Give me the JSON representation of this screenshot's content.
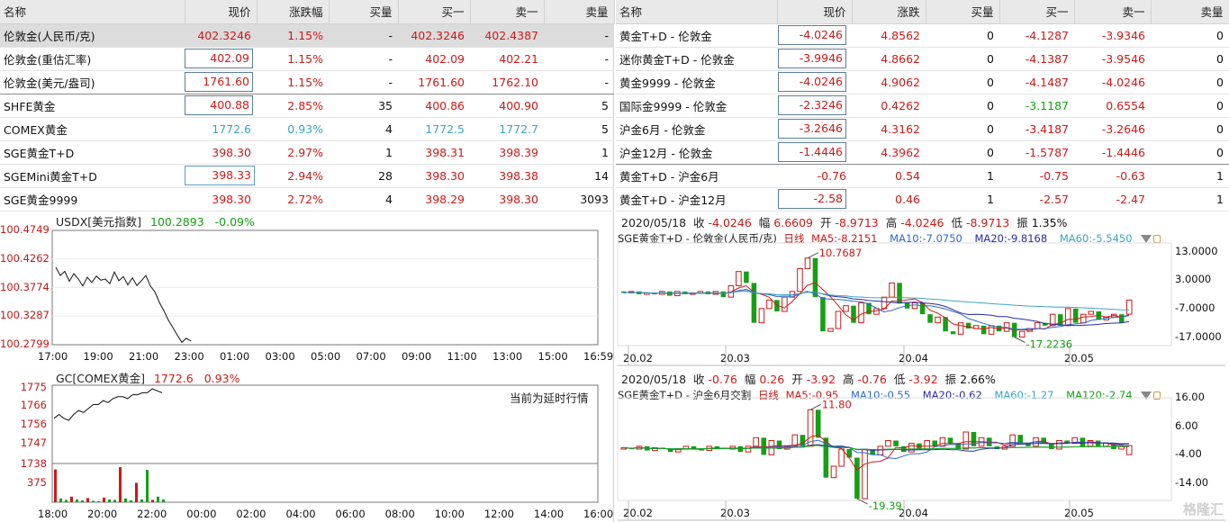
{
  "left_table": {
    "headers": [
      "名称",
      "现价",
      "涨跌幅",
      "买量",
      "买一",
      "卖一",
      "卖量"
    ],
    "rows": [
      {
        "name": "伦敦金(人民币/克)",
        "price": "402.3246",
        "chg": "1.15%",
        "bvol": "-",
        "bid": "402.3246",
        "ask": "402.4387",
        "avol": "-"
      },
      {
        "name": "伦敦金(重估汇率)",
        "price": "402.09",
        "chg": "1.15%",
        "bvol": "-",
        "bid": "402.09",
        "ask": "402.21",
        "avol": "-"
      },
      {
        "name": "伦敦金(美元/盎司)",
        "price": "1761.60",
        "chg": "1.15%",
        "bvol": "-",
        "bid": "1761.60",
        "ask": "1762.10",
        "avol": "-"
      },
      {
        "name": "SHFE黄金",
        "price": "400.88",
        "chg": "2.85%",
        "bvol": "35",
        "bid": "400.86",
        "ask": "400.90",
        "avol": "5"
      },
      {
        "name": "COMEX黄金",
        "price": "1772.6",
        "chg": "0.93%",
        "bvol": "4",
        "bid": "1772.5",
        "ask": "1772.7",
        "avol": "5"
      },
      {
        "name": "SGE黄金T+D",
        "price": "398.30",
        "chg": "2.97%",
        "bvol": "1",
        "bid": "398.31",
        "ask": "398.39",
        "avol": "1"
      },
      {
        "name": "SGEMini黄金T+D",
        "price": "398.33",
        "chg": "2.94%",
        "bvol": "28",
        "bid": "398.30",
        "ask": "398.38",
        "avol": "14"
      },
      {
        "name": "SGE黄金9999",
        "price": "398.30",
        "chg": "2.72%",
        "bvol": "4",
        "bid": "398.29",
        "ask": "398.30",
        "avol": "3093"
      }
    ]
  },
  "right_table": {
    "headers": [
      "名称",
      "现价",
      "涨跌",
      "买量",
      "买一",
      "卖一",
      "卖量"
    ],
    "rows": [
      {
        "name": "黄金T+D - 伦敦金",
        "price": "-4.0246",
        "chg": "4.8562",
        "bvol": "0",
        "bid": "-4.1287",
        "ask": "-3.9346",
        "avol": "0"
      },
      {
        "name": "迷你黄金T+D - 伦敦金",
        "price": "-3.9946",
        "chg": "4.8662",
        "bvol": "0",
        "bid": "-4.1387",
        "ask": "-3.9546",
        "avol": "0"
      },
      {
        "name": "黄金9999 - 伦敦金",
        "price": "-4.0246",
        "chg": "4.9062",
        "bvol": "0",
        "bid": "-4.1487",
        "ask": "-4.0246",
        "avol": "0"
      },
      {
        "name": "国际金9999 - 伦敦金",
        "price": "-2.3246",
        "chg": "0.4262",
        "bvol": "0",
        "bid": "-3.1187",
        "ask": "0.6554",
        "avol": "0"
      },
      {
        "name": "沪金6月 - 伦敦金",
        "price": "-3.2646",
        "chg": "4.3162",
        "bvol": "0",
        "bid": "-3.4187",
        "ask": "-3.2646",
        "avol": "0"
      },
      {
        "name": "沪金12月 - 伦敦金",
        "price": "-1.4446",
        "chg": "4.3962",
        "bvol": "0",
        "bid": "-1.5787",
        "ask": "-1.4446",
        "avol": "0"
      },
      {
        "name": "黄金T+D - 沪金6月",
        "price": "-0.76",
        "chg": "0.54",
        "bvol": "1",
        "bid": "-0.75",
        "ask": "-0.63",
        "avol": "1"
      },
      {
        "name": "黄金T+D - 沪金12月",
        "price": "-2.58",
        "chg": "0.46",
        "bvol": "1",
        "bid": "-2.57",
        "ask": "-2.47",
        "avol": "1"
      }
    ]
  },
  "usdx": {
    "name": "USDX[美元指数]",
    "value": "100.2893",
    "chg": "-0.09%"
  },
  "gc": {
    "name": "GC[COMEX黄金]",
    "value": "1772.6",
    "chg": "0.93%",
    "note": "当前为延时行情"
  },
  "kline1": {
    "date": "2020/05/18",
    "close_lbl": "收",
    "close": "-4.0246",
    "amp_lbl": "幅",
    "amp": "6.6609",
    "open_lbl": "开",
    "open": "-8.9713",
    "high_lbl": "高",
    "high": "-4.0246",
    "low_lbl": "低",
    "low": "-8.9713",
    "swing_lbl": "振",
    "swing": "1.35%",
    "name": "SGE黄金T+D - 伦敦金(人民币/克)",
    "period": "日线",
    "ma5": "MA5:-8.2151",
    "ma10": "MA10:-7.0750",
    "ma20": "MA20:-9.8168",
    "ma60": "MA60:-5.5450",
    "max_label": "10.7687",
    "min_label": "-17.2236"
  },
  "kline2": {
    "date": "2020/05/18",
    "close_lbl": "收",
    "close": "-0.76",
    "amp_lbl": "幅",
    "amp": "0.26",
    "open_lbl": "开",
    "open": "-3.92",
    "high_lbl": "高",
    "high": "-0.76",
    "low_lbl": "低",
    "low": "-3.92",
    "swing_lbl": "振",
    "swing": "2.66%",
    "name": "SGE黄金T+D - 沪金6月交割",
    "period": "日线",
    "ma5": "MA5:-0.95",
    "ma10": "MA10:-0.55",
    "ma20": "MA20:-0.62",
    "ma60": "MA60:-1.27",
    "ma120": "MA120:-2.74",
    "max_label": "11.80",
    "min_label": "-19.39"
  },
  "logo": "格隆汇",
  "chart_data": [
    {
      "type": "line",
      "title": "USDX[美元指数]",
      "yticks": [
        "100.4749",
        "100.4262",
        "100.3774",
        "100.3287",
        "100.2799"
      ],
      "xticks": [
        "17:00",
        "19:00",
        "21:00",
        "23:00",
        "01:00",
        "03:00",
        "05:00",
        "07:00",
        "09:00",
        "11:00",
        "13:00",
        "15:00",
        "16:59"
      ],
      "ylim": [
        100.2799,
        100.4749
      ],
      "series": [
        {
          "values": [
            100.412,
            100.398,
            100.405,
            100.388,
            100.401,
            100.392,
            100.38,
            100.395,
            100.386,
            100.397,
            100.39,
            100.392,
            100.384,
            100.404,
            100.389,
            100.396,
            100.382,
            100.394,
            100.381,
            100.389,
            100.398,
            100.38,
            100.37,
            100.352,
            100.338,
            100.322,
            100.309,
            100.296,
            100.284,
            100.291,
            100.286
          ]
        }
      ]
    },
    {
      "type": "line",
      "title": "GC[COMEX黄金]",
      "yticks": [
        "1775",
        "1766",
        "1756",
        "1747",
        "1738",
        "375"
      ],
      "xticks": [
        "18:00",
        "20:00",
        "22:00",
        "00:00",
        "02:00",
        "04:00",
        "06:00",
        "08:00",
        "10:00",
        "12:00",
        "14:00",
        "16:00"
      ],
      "ylim": [
        1738,
        1775
      ],
      "series": [
        {
          "values": [
            1760,
            1762,
            1760,
            1759,
            1762,
            1764,
            1763,
            1765,
            1767,
            1767,
            1769,
            1768,
            1770,
            1771,
            1771,
            1770,
            1772,
            1772,
            1773,
            1773,
            1775,
            1774,
            1773
          ]
        }
      ],
      "volume": [
        355,
        40,
        25,
        60,
        30,
        20,
        45,
        15,
        10,
        50,
        30,
        25,
        380,
        40,
        20,
        210,
        30,
        350,
        25,
        60,
        30
      ]
    },
    {
      "type": "bar",
      "title": "SGE黄金T+D - 伦敦金(人民币/克)",
      "yticks": [
        "13.0000",
        "3.0000",
        "-7.0000",
        "-17.0000"
      ],
      "xticks": [
        "20.02",
        "20.03",
        "20.04",
        "20.05"
      ],
      "ylim": [
        -20,
        16
      ],
      "candles": [
        [
          -1,
          -1.5
        ],
        [
          -1.5,
          -1
        ],
        [
          -1,
          -2
        ],
        [
          -2,
          -1.5
        ],
        [
          -1.5,
          -2
        ],
        [
          -2,
          -1
        ],
        [
          -1,
          -2.5
        ],
        [
          -2.5,
          -1
        ],
        [
          -1,
          -2
        ],
        [
          -2,
          -1.5
        ],
        [
          -1.5,
          -1
        ],
        [
          -1,
          -2
        ],
        [
          -2,
          -1
        ],
        [
          -1,
          -3
        ],
        [
          -3,
          1
        ],
        [
          1,
          6
        ],
        [
          6,
          2
        ],
        [
          2,
          -12
        ],
        [
          -12,
          -7
        ],
        [
          -7,
          -4
        ],
        [
          -4,
          -8
        ],
        [
          -8,
          -3
        ],
        [
          -3,
          -1
        ],
        [
          -1,
          7
        ],
        [
          7,
          10.7
        ],
        [
          10.7,
          -3
        ],
        [
          -3,
          -15
        ],
        [
          -15,
          -14
        ],
        [
          -14,
          -8
        ],
        [
          -8,
          -6
        ],
        [
          -6,
          -12
        ],
        [
          -12,
          -5
        ],
        [
          -5,
          -9
        ],
        [
          -9,
          -7
        ],
        [
          -7,
          -3
        ],
        [
          -3,
          2
        ],
        [
          2,
          -5
        ],
        [
          -5,
          -7
        ],
        [
          -7,
          -5
        ],
        [
          -5,
          -9
        ],
        [
          -9,
          -12
        ],
        [
          -12,
          -10
        ],
        [
          -10,
          -15
        ],
        [
          -15,
          -16
        ],
        [
          -16,
          -12
        ],
        [
          -12,
          -14
        ],
        [
          -14,
          -13
        ],
        [
          -13,
          -16
        ],
        [
          -16,
          -13
        ],
        [
          -13,
          -15
        ],
        [
          -15,
          -12
        ],
        [
          -12,
          -17
        ],
        [
          -17,
          -15
        ],
        [
          -15,
          -14
        ],
        [
          -14,
          -12
        ],
        [
          -12,
          -13
        ],
        [
          -13,
          -9
        ],
        [
          -9,
          -13
        ],
        [
          -13,
          -7
        ],
        [
          -7,
          -12
        ],
        [
          -12,
          -9
        ],
        [
          -9,
          -8
        ],
        [
          -8,
          -11
        ],
        [
          -11,
          -10
        ],
        [
          -10,
          -9
        ],
        [
          -9,
          -12
        ],
        [
          -8.97,
          -4.02
        ]
      ]
    },
    {
      "type": "bar",
      "title": "SGE黄金T+D - 沪金6月交割",
      "yticks": [
        "16.00",
        "6.00",
        "-4.00",
        "-14.00"
      ],
      "xticks": [
        "20.02",
        "20.03",
        "20.04",
        "20.05"
      ],
      "ylim": [
        -20,
        16
      ],
      "candles": [
        [
          -2,
          -1.5
        ],
        [
          -1.5,
          -2
        ],
        [
          -2,
          -1
        ],
        [
          -1,
          -2.5
        ],
        [
          -2.5,
          -1.5
        ],
        [
          -1.5,
          -2
        ],
        [
          -2,
          -3
        ],
        [
          -3,
          -2
        ],
        [
          -2,
          -1
        ],
        [
          -1,
          -2
        ],
        [
          -2,
          -2.5
        ],
        [
          -2.5,
          -1
        ],
        [
          -1,
          -1.5
        ],
        [
          -1.5,
          -2
        ],
        [
          -2,
          -1
        ],
        [
          -1,
          -3
        ],
        [
          -3,
          -1
        ],
        [
          -1,
          2
        ],
        [
          2,
          -4
        ],
        [
          -4,
          1
        ],
        [
          1,
          -2
        ],
        [
          -2,
          -1
        ],
        [
          -1,
          3
        ],
        [
          3,
          -1
        ],
        [
          -1,
          11.8
        ],
        [
          11.8,
          2
        ],
        [
          2,
          -12
        ],
        [
          -12,
          -8
        ],
        [
          -8,
          -2
        ],
        [
          -2,
          -5
        ],
        [
          -5,
          -19.4
        ],
        [
          -19.4,
          -2
        ],
        [
          -2,
          -4
        ],
        [
          -4,
          -1
        ],
        [
          -1,
          1
        ],
        [
          1,
          -1
        ],
        [
          -1,
          -3
        ],
        [
          -3,
          0
        ],
        [
          0,
          -2
        ],
        [
          -2,
          1
        ],
        [
          1,
          -1
        ],
        [
          -1,
          2
        ],
        [
          2,
          0
        ],
        [
          0,
          -2
        ],
        [
          -2,
          4
        ],
        [
          4,
          -1
        ],
        [
          -1,
          2
        ],
        [
          2,
          -1
        ],
        [
          -1,
          -2
        ],
        [
          -2,
          -1
        ],
        [
          -1,
          3
        ],
        [
          3,
          0
        ],
        [
          0,
          -1
        ],
        [
          -1,
          2
        ],
        [
          2,
          0
        ],
        [
          0,
          -2
        ],
        [
          -2,
          1
        ],
        [
          1,
          0
        ],
        [
          0,
          2
        ],
        [
          2,
          -1
        ],
        [
          -1,
          1
        ],
        [
          1,
          -1
        ],
        [
          -1,
          0
        ],
        [
          0,
          -2
        ],
        [
          -2,
          -1
        ],
        [
          -3.92,
          -0.76
        ]
      ]
    }
  ]
}
